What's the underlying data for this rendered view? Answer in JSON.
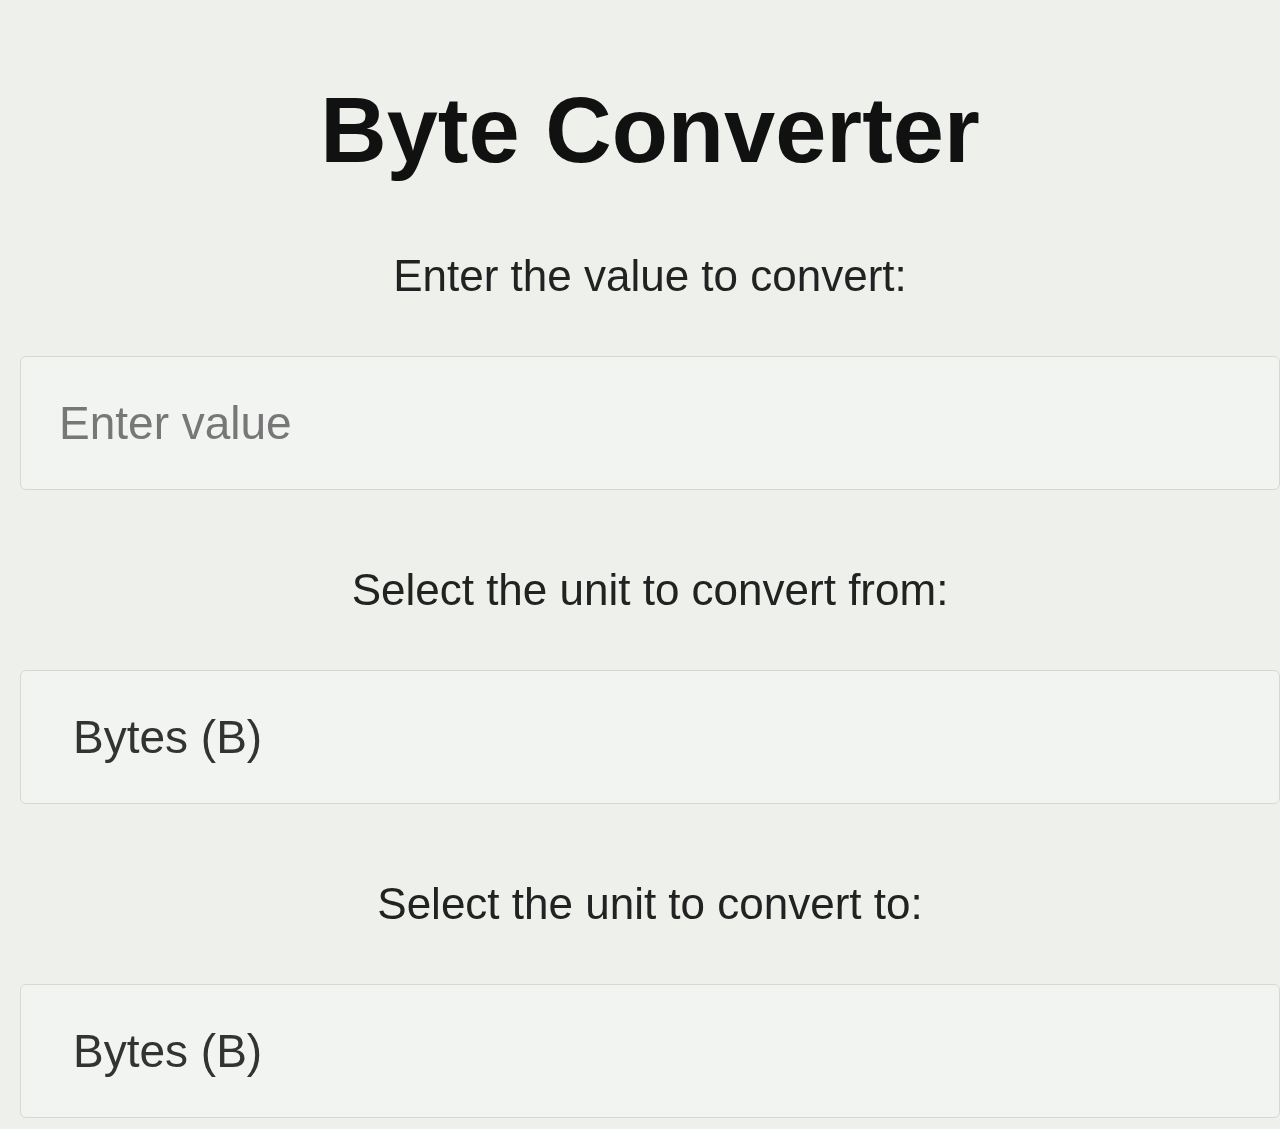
{
  "title": "Byte Converter",
  "fields": [
    {
      "kind": "text",
      "label": "Enter the value to convert:",
      "placeholder": "Enter value"
    },
    {
      "kind": "select",
      "label": "Select the unit to convert from:",
      "value": "Bytes (B)"
    },
    {
      "kind": "select",
      "label": "Select the unit to convert to:",
      "value": "Bytes (B)"
    }
  ]
}
